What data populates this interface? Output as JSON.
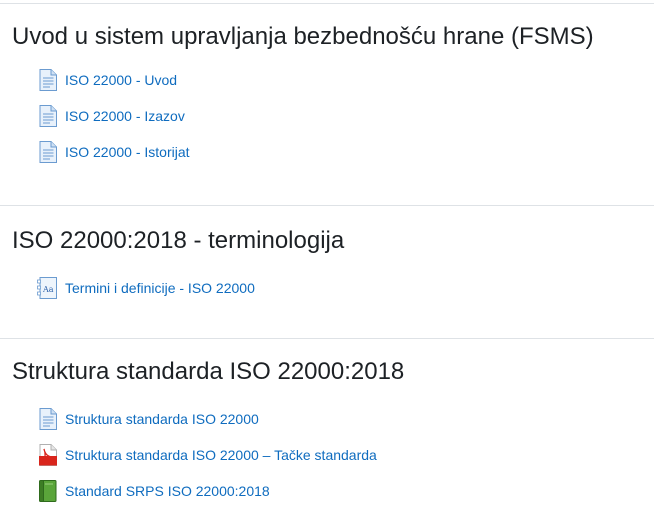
{
  "sections": [
    {
      "title": "Uvod u sistem upravljanja bezbednošću hrane (FSMS)",
      "activities": [
        {
          "label": "ISO 22000 - Uvod",
          "icon": "page-icon"
        },
        {
          "label": "ISO 22000 - Izazov",
          "icon": "page-icon"
        },
        {
          "label": "ISO 22000 - Istorijat",
          "icon": "page-icon"
        }
      ]
    },
    {
      "title": "ISO 22000:2018 - terminologija",
      "activities": [
        {
          "label": "Termini i definicije - ISO 22000",
          "icon": "glossary-icon"
        }
      ]
    },
    {
      "title": "Struktura standarda ISO 22000:2018",
      "activities": [
        {
          "label": "Struktura standarda ISO 22000",
          "icon": "page-icon"
        },
        {
          "label": "Struktura standarda ISO 22000 – Tačke standarda",
          "icon": "pdf-icon"
        },
        {
          "label": "Standard SRPS ISO 22000:2018",
          "icon": "book-icon"
        }
      ]
    }
  ],
  "colors": {
    "link": "#0f6cbf",
    "title": "#1d2125",
    "divider": "#dee2e6"
  }
}
